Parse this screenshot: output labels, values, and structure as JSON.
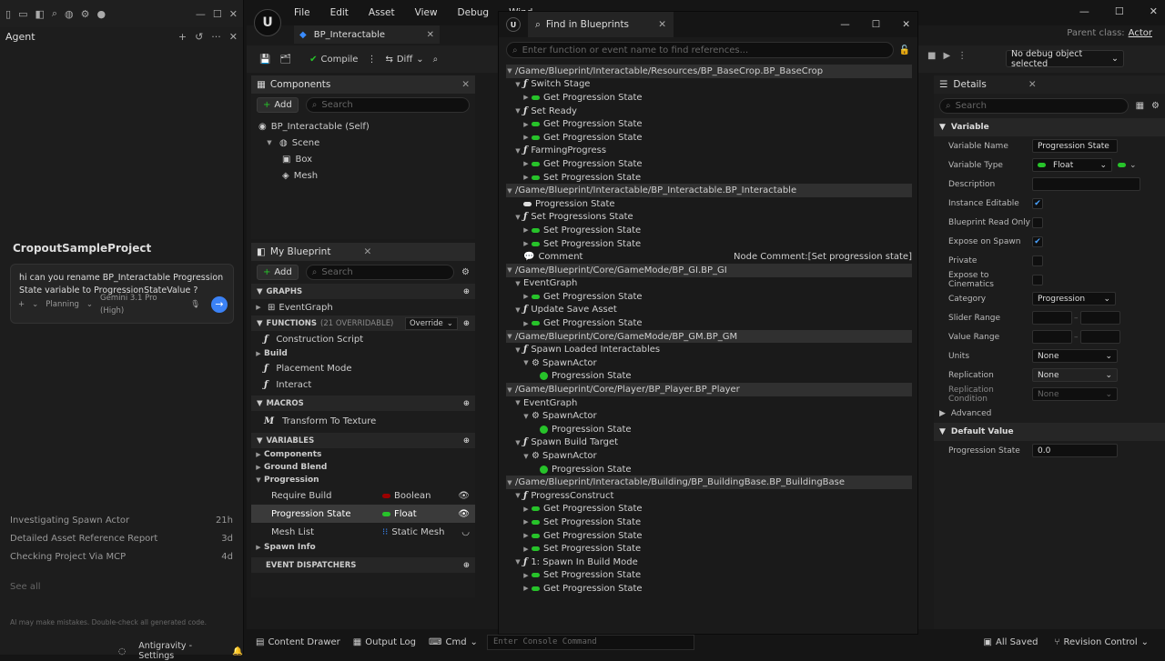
{
  "agent": {
    "title": "Agent",
    "project": "CropoutSampleProject",
    "prompt_text": "hi can you rename BP_Interactable Progression State variable to ProgressionStateValue ?",
    "mode": "Planning",
    "model": "Gemini 3.1 Pro (High)",
    "conversations": [
      {
        "title": "Investigating Spawn Actor",
        "age": "21h"
      },
      {
        "title": "Detailed Asset Reference Report",
        "age": "3d"
      },
      {
        "title": "Checking Project Via MCP",
        "age": "4d"
      }
    ],
    "see_all": "See all",
    "disclaimer": "AI may make mistakes. Double-check all generated code.",
    "footer": "Antigravity - Settings"
  },
  "ue": {
    "menu": [
      "File",
      "Edit",
      "Asset",
      "View",
      "Debug",
      "Wind"
    ],
    "tab": "BP_Interactable",
    "parent_class_label": "Parent class:",
    "parent_class_value": "Actor",
    "toolbar": {
      "compile": "Compile",
      "diff": "Diff",
      "debug_object": "No debug object selected"
    },
    "components": {
      "title": "Components",
      "add": "Add",
      "search_placeholder": "Search",
      "tree": [
        "BP_Interactable (Self)",
        "Scene",
        "Box",
        "Mesh"
      ]
    },
    "my_blueprint": {
      "title": "My Blueprint",
      "add": "Add",
      "search_placeholder": "Search",
      "graphs_label": "GRAPHS",
      "event_graph": "EventGraph",
      "functions_label": "FUNCTIONS",
      "functions_count": "(21 OVERRIDABLE)",
      "override": "Override",
      "construction_script": "Construction Script",
      "build": "Build",
      "placement_mode": "Placement Mode",
      "interact": "Interact",
      "macros_label": "MACROS",
      "transform_to_texture": "Transform To Texture",
      "variables_label": "VARIABLES",
      "var_components": "Components",
      "var_ground_blend": "Ground Blend",
      "var_progression": "Progression",
      "variables": [
        {
          "name": "Require Build",
          "type": "Boolean",
          "color": "#9b0000"
        },
        {
          "name": "Progression State",
          "type": "Float",
          "color": "#27c32a"
        },
        {
          "name": "Mesh List",
          "type": "Static Mesh",
          "color": "#3a8cff"
        }
      ],
      "spawn_info": "Spawn Info",
      "event_dispatchers_label": "EVENT DISPATCHERS"
    },
    "details": {
      "title": "Details",
      "search_placeholder": "Search",
      "variable_section": "Variable",
      "rows": {
        "variable_name_label": "Variable Name",
        "variable_name_value": "Progression State",
        "variable_type_label": "Variable Type",
        "variable_type_value": "Float",
        "description_label": "Description",
        "instance_editable_label": "Instance Editable",
        "blueprint_read_only_label": "Blueprint Read Only",
        "expose_on_spawn_label": "Expose on Spawn",
        "private_label": "Private",
        "expose_cinematics_label": "Expose to Cinematics",
        "category_label": "Category",
        "category_value": "Progression",
        "slider_range_label": "Slider Range",
        "value_range_label": "Value Range",
        "units_label": "Units",
        "units_value": "None",
        "replication_label": "Replication",
        "replication_value": "None",
        "replication_condition_label": "Replication Condition",
        "replication_condition_value": "None"
      },
      "advanced": "Advanced",
      "default_section": "Default Value",
      "default_label": "Progression State",
      "default_value": "0.0"
    },
    "status": {
      "content_drawer": "Content Drawer",
      "output_log": "Output Log",
      "cmd": "Cmd",
      "console_placeholder": "Enter Console Command",
      "all_saved": "All Saved",
      "revision_control": "Revision Control"
    }
  },
  "find": {
    "title": "Find in Blueprints",
    "search_placeholder": "Enter function or event name to find references...",
    "results": [
      {
        "kind": "head",
        "text": "/Game/Blueprint/Interactable/Resources/BP_BaseCrop.BP_BaseCrop"
      },
      {
        "kind": "fn",
        "indent": 1,
        "text": "Switch Stage"
      },
      {
        "kind": "pill",
        "indent": 2,
        "text": "Get Progression State"
      },
      {
        "kind": "fn",
        "indent": 1,
        "text": "Set Ready"
      },
      {
        "kind": "pill",
        "indent": 2,
        "text": "Get Progression State"
      },
      {
        "kind": "pill",
        "indent": 2,
        "text": "Get Progression State"
      },
      {
        "kind": "fn",
        "indent": 1,
        "text": "FarmingProgress"
      },
      {
        "kind": "pill",
        "indent": 2,
        "text": "Get Progression State"
      },
      {
        "kind": "pill",
        "indent": 2,
        "text": "Set Progression State"
      },
      {
        "kind": "head",
        "text": "/Game/Blueprint/Interactable/BP_Interactable.BP_Interactable"
      },
      {
        "kind": "var",
        "indent": 1,
        "text": "Progression State"
      },
      {
        "kind": "fn",
        "indent": 1,
        "text": "Set Progressions State"
      },
      {
        "kind": "pill",
        "indent": 2,
        "text": "Set Progression State"
      },
      {
        "kind": "pill",
        "indent": 2,
        "text": "Set Progression State"
      },
      {
        "kind": "comment",
        "indent": 1,
        "text": "Comment",
        "extra": "Node Comment:[Set progression state]"
      },
      {
        "kind": "head",
        "text": "/Game/Blueprint/Core/GameMode/BP_GI.BP_GI"
      },
      {
        "kind": "plain",
        "indent": 1,
        "text": "EventGraph"
      },
      {
        "kind": "pill",
        "indent": 2,
        "text": "Get Progression State"
      },
      {
        "kind": "fn",
        "indent": 1,
        "text": "Update Save Asset"
      },
      {
        "kind": "pill",
        "indent": 2,
        "text": "Get Progression State"
      },
      {
        "kind": "head",
        "text": "/Game/Blueprint/Core/GameMode/BP_GM.BP_GM"
      },
      {
        "kind": "fn",
        "indent": 1,
        "text": "Spawn Loaded Interactables"
      },
      {
        "kind": "spawn",
        "indent": 2,
        "text": "SpawnActor"
      },
      {
        "kind": "dot",
        "indent": 3,
        "text": "Progression State"
      },
      {
        "kind": "head",
        "text": "/Game/Blueprint/Core/Player/BP_Player.BP_Player"
      },
      {
        "kind": "plain",
        "indent": 1,
        "text": "EventGraph"
      },
      {
        "kind": "spawn",
        "indent": 2,
        "text": "SpawnActor"
      },
      {
        "kind": "dot",
        "indent": 3,
        "text": "Progression State"
      },
      {
        "kind": "fn",
        "indent": 1,
        "text": "Spawn Build Target"
      },
      {
        "kind": "spawn",
        "indent": 2,
        "text": "SpawnActor"
      },
      {
        "kind": "dot",
        "indent": 3,
        "text": "Progression State"
      },
      {
        "kind": "head",
        "text": "/Game/Blueprint/Interactable/Building/BP_BuildingBase.BP_BuildingBase"
      },
      {
        "kind": "fn",
        "indent": 1,
        "text": "ProgressConstruct"
      },
      {
        "kind": "pill",
        "indent": 2,
        "text": "Get Progression State"
      },
      {
        "kind": "pill",
        "indent": 2,
        "text": "Set Progression State"
      },
      {
        "kind": "pill",
        "indent": 2,
        "text": "Get Progression State"
      },
      {
        "kind": "pill",
        "indent": 2,
        "text": "Set Progression State"
      },
      {
        "kind": "fn",
        "indent": 1,
        "text": "1: Spawn In Build Mode"
      },
      {
        "kind": "pill",
        "indent": 2,
        "text": "Set Progression State"
      },
      {
        "kind": "pill",
        "indent": 2,
        "text": "Get Progression State"
      }
    ]
  }
}
